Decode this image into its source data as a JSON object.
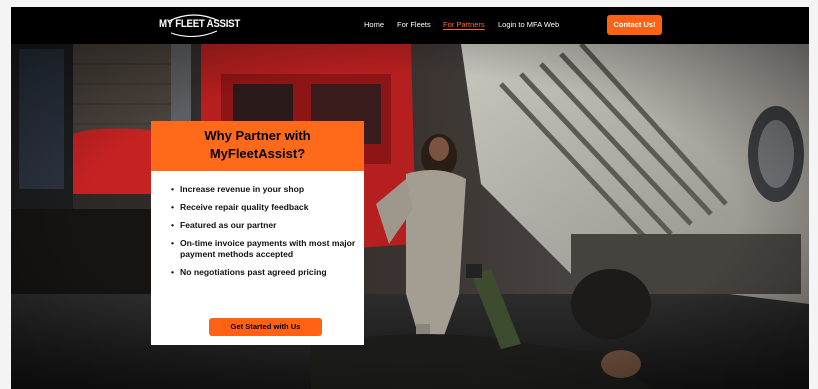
{
  "header": {
    "logo_text": "MY FLEET ASSIST",
    "nav": [
      {
        "label": "Home"
      },
      {
        "label": "For Fleets"
      },
      {
        "label": "For Partners"
      },
      {
        "label": "Login to MFA Web"
      }
    ],
    "contact_label": "Contact Us!"
  },
  "card": {
    "title": "Why Partner with MyFleetAssist?",
    "benefits": [
      "Increase revenue in your shop",
      "Receive repair quality feedback",
      "Featured as our partner",
      "On-time invoice payments with most major payment methods accepted",
      "No negotiations past agreed pricing"
    ],
    "cta_label": "Get Started with Us"
  },
  "colors": {
    "accent": "#ff6a1a",
    "header_bg": "#000000",
    "card_bg": "#ffffff"
  },
  "icons": [
    "logo-arc"
  ]
}
